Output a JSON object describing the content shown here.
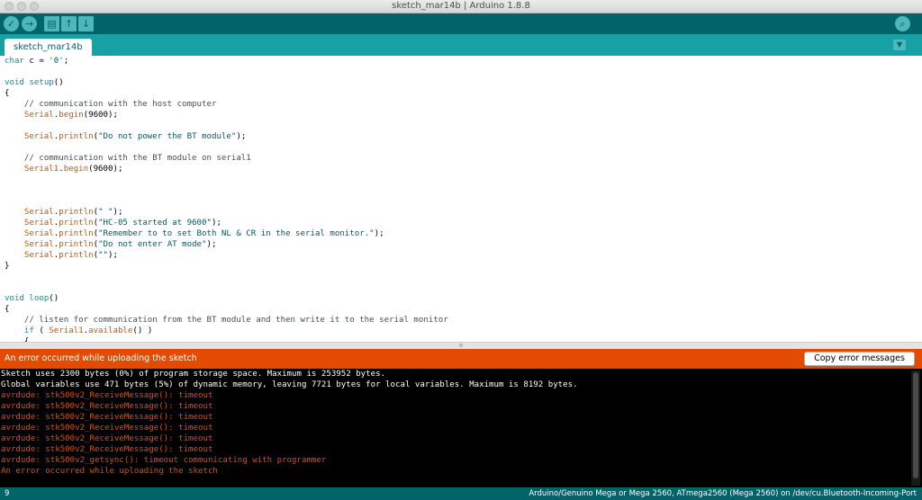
{
  "window": {
    "title": "sketch_mar14b | Arduino 1.8.8"
  },
  "toolbar": {
    "verify_icon": "✓",
    "upload_icon": "→",
    "new_icon": "▤",
    "open_icon": "↑",
    "save_icon": "↓",
    "serial_monitor_icon": "⌕"
  },
  "tab": {
    "label": "sketch_mar14b",
    "menu_icon": "▼"
  },
  "code": {
    "lines": [
      [
        {
          "t": "char",
          "c": "kw"
        },
        {
          "t": " c = "
        },
        {
          "t": "'0'",
          "c": "str"
        },
        {
          "t": ";"
        }
      ],
      [],
      [
        {
          "t": "void",
          "c": "kw"
        },
        {
          "t": " "
        },
        {
          "t": "setup",
          "c": "kw"
        },
        {
          "t": "()"
        }
      ],
      [
        {
          "t": "{"
        }
      ],
      [
        {
          "t": "    // communication with the host computer",
          "c": "cm"
        }
      ],
      [
        {
          "t": "    "
        },
        {
          "t": "Serial",
          "c": "fn"
        },
        {
          "t": "."
        },
        {
          "t": "begin",
          "c": "fn"
        },
        {
          "t": "(9600);"
        }
      ],
      [],
      [
        {
          "t": "    "
        },
        {
          "t": "Serial",
          "c": "fn"
        },
        {
          "t": "."
        },
        {
          "t": "println",
          "c": "fn"
        },
        {
          "t": "("
        },
        {
          "t": "\"Do not power the BT module\"",
          "c": "str"
        },
        {
          "t": ");"
        }
      ],
      [],
      [
        {
          "t": "    // communication with the BT module on serial1",
          "c": "cm"
        }
      ],
      [
        {
          "t": "    "
        },
        {
          "t": "Serial1",
          "c": "fn"
        },
        {
          "t": "."
        },
        {
          "t": "begin",
          "c": "fn"
        },
        {
          "t": "(9600);"
        }
      ],
      [],
      [],
      [],
      [
        {
          "t": "    "
        },
        {
          "t": "Serial",
          "c": "fn"
        },
        {
          "t": "."
        },
        {
          "t": "println",
          "c": "fn"
        },
        {
          "t": "("
        },
        {
          "t": "\" \"",
          "c": "str"
        },
        {
          "t": ");"
        }
      ],
      [
        {
          "t": "    "
        },
        {
          "t": "Serial",
          "c": "fn"
        },
        {
          "t": "."
        },
        {
          "t": "println",
          "c": "fn"
        },
        {
          "t": "("
        },
        {
          "t": "\"HC-05 started at 9600\"",
          "c": "str"
        },
        {
          "t": ");"
        }
      ],
      [
        {
          "t": "    "
        },
        {
          "t": "Serial",
          "c": "fn"
        },
        {
          "t": "."
        },
        {
          "t": "println",
          "c": "fn"
        },
        {
          "t": "("
        },
        {
          "t": "\"Remember to to set Both NL & CR in the serial monitor.\"",
          "c": "str"
        },
        {
          "t": ");"
        }
      ],
      [
        {
          "t": "    "
        },
        {
          "t": "Serial",
          "c": "fn"
        },
        {
          "t": "."
        },
        {
          "t": "println",
          "c": "fn"
        },
        {
          "t": "("
        },
        {
          "t": "\"Do not enter AT mode\"",
          "c": "str"
        },
        {
          "t": ");"
        }
      ],
      [
        {
          "t": "    "
        },
        {
          "t": "Serial",
          "c": "fn"
        },
        {
          "t": "."
        },
        {
          "t": "println",
          "c": "fn"
        },
        {
          "t": "("
        },
        {
          "t": "\"\"",
          "c": "str"
        },
        {
          "t": ");"
        }
      ],
      [
        {
          "t": "}"
        }
      ],
      [],
      [],
      [
        {
          "t": "void",
          "c": "kw"
        },
        {
          "t": " "
        },
        {
          "t": "loop",
          "c": "kw"
        },
        {
          "t": "()"
        }
      ],
      [
        {
          "t": "{"
        }
      ],
      [
        {
          "t": "    // listen for communication from the BT module and then write it to the serial monitor",
          "c": "cm"
        }
      ],
      [
        {
          "t": "    "
        },
        {
          "t": "if",
          "c": "kw"
        },
        {
          "t": " ( "
        },
        {
          "t": "Serial1",
          "c": "fn"
        },
        {
          "t": "."
        },
        {
          "t": "available",
          "c": "fn"
        },
        {
          "t": "() )"
        }
      ],
      [
        {
          "t": "    {"
        }
      ]
    ]
  },
  "error_bar": {
    "message": "An error occurred while uploading the sketch",
    "copy_button": "Copy error messages"
  },
  "console": {
    "lines": [
      {
        "text": "Sketch uses 2300 bytes (0%) of program storage space. Maximum is 253952 bytes.",
        "color": "white"
      },
      {
        "text": "Global variables use 471 bytes (5%) of dynamic memory, leaving 7721 bytes for local variables. Maximum is 8192 bytes.",
        "color": "white"
      },
      {
        "text": "avrdude: stk500v2_ReceiveMessage(): timeout",
        "color": "orange"
      },
      {
        "text": "avrdude: stk500v2_ReceiveMessage(): timeout",
        "color": "orange"
      },
      {
        "text": "avrdude: stk500v2_ReceiveMessage(): timeout",
        "color": "orange"
      },
      {
        "text": "avrdude: stk500v2_ReceiveMessage(): timeout",
        "color": "orange"
      },
      {
        "text": "avrdude: stk500v2_ReceiveMessage(): timeout",
        "color": "orange"
      },
      {
        "text": "avrdude: stk500v2_ReceiveMessage(): timeout",
        "color": "orange"
      },
      {
        "text": "avrdude: stk500v2_getsync(): timeout communicating with programmer",
        "color": "orange"
      },
      {
        "text": "An error occurred while uploading the sketch",
        "color": "orange"
      }
    ]
  },
  "status": {
    "line_number": "9",
    "board": "Arduino/Genuino Mega or Mega 2560, ATmega2560 (Mega 2560) on /dev/cu.Bluetooth-Incoming-Port"
  },
  "colors": {
    "toolbar": "#006468",
    "tabbar": "#17a1a5",
    "error": "#e34c00",
    "console": "#000000"
  }
}
